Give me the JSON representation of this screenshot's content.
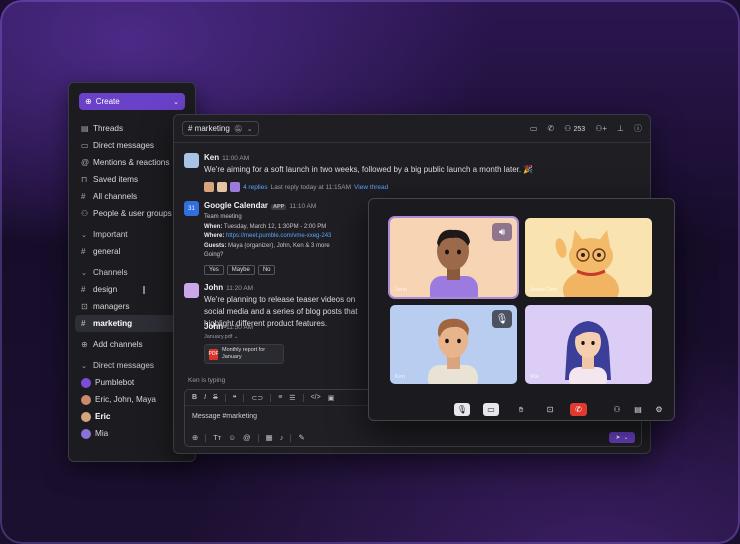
{
  "colors": {
    "accent": "#6a42c9",
    "link": "#5aa4ff",
    "end_call": "#e03a2f"
  },
  "sidebar": {
    "create_label": "Create",
    "top_items": [
      {
        "label": "Threads",
        "icon": "threads-icon"
      },
      {
        "label": "Direct messages",
        "icon": "message-icon"
      },
      {
        "label": "Mentions & reactions",
        "icon": "at-icon"
      },
      {
        "label": "Saved items",
        "icon": "bookmark-icon"
      },
      {
        "label": "All channels",
        "icon": "hash-icon"
      },
      {
        "label": "People & user groups",
        "icon": "people-icon"
      }
    ],
    "important_label": "Important",
    "important_items": [
      {
        "label": "general"
      }
    ],
    "channels_label": "Channels",
    "channel_items": [
      {
        "label": "design"
      },
      {
        "label": "managers"
      },
      {
        "label": "marketing"
      }
    ],
    "add_channels_label": "Add channels",
    "dm_label": "Direct messages",
    "dm_items": [
      {
        "label": "Pumblebot"
      },
      {
        "label": "Eric, John, Maya"
      },
      {
        "label": "Eric"
      },
      {
        "label": "Mia"
      }
    ]
  },
  "chat": {
    "channel": "# marketing",
    "member_count": "253",
    "messages": {
      "ken": {
        "name": "Ken",
        "time": "11:00 AM",
        "text": "We're aiming for a soft launch in two weeks, followed by a big public launch a month later. 🎉",
        "replies": "4 replies",
        "last_reply": "Last reply today at 11:15AM",
        "view_thread": "View thread"
      },
      "gcal": {
        "name": "Google Calendar",
        "app_tag": "APP",
        "time": "11:10 AM",
        "event_title": "Team meeting",
        "when_label": "When:",
        "when_value": "Tuesday, March 12, 1:30PM - 2:00 PM",
        "where_label": "Where:",
        "where_value": "https://meet.pumble.com/vme-xxeg-243",
        "guests_label": "Guests:",
        "guests_value": "Maya (organizer), John, Ken & 3 more",
        "going": "Going?",
        "yes": "Yes",
        "maybe": "Maybe",
        "no": "No"
      },
      "john1": {
        "name": "John",
        "time": "11:20 AM",
        "text": "We're planning to release teaser videos on social media and a series of blog posts that highlight different product features."
      },
      "john2": {
        "name": "John",
        "time": "11:50 AM",
        "file_label": "January.pdf",
        "file_name": "Monthly report for January",
        "file_type": "PDF"
      }
    },
    "typing": "Ken is typing",
    "composer_placeholder": "Message #marketing"
  },
  "call": {
    "tiles": [
      {
        "label": "John"
      },
      {
        "label": "Jessie Doe"
      },
      {
        "label": "Ken"
      },
      {
        "label": "Mia"
      }
    ]
  }
}
